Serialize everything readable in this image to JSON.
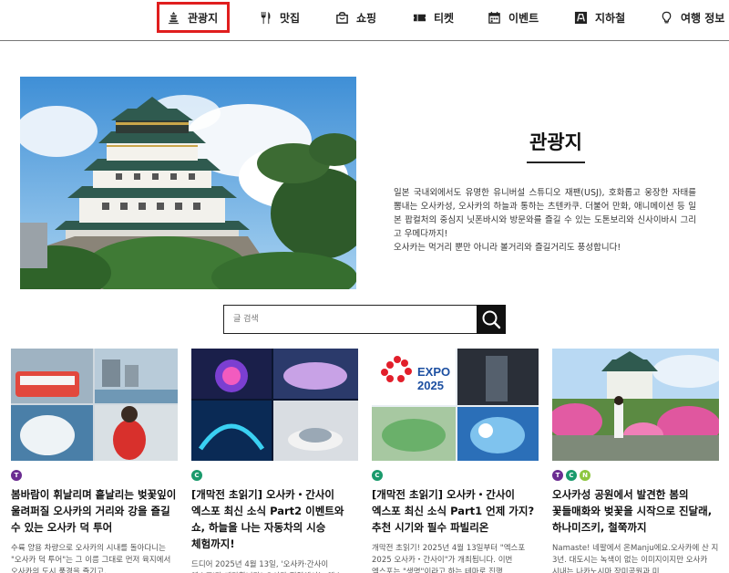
{
  "nav": {
    "items": [
      {
        "label": "관광지",
        "icon": "pagoda-icon",
        "active": true
      },
      {
        "label": "맛집",
        "icon": "fork-knife-icon"
      },
      {
        "label": "쇼핑",
        "icon": "shopping-bag-icon"
      },
      {
        "label": "티켓",
        "icon": "ticket-icon"
      },
      {
        "label": "이벤트",
        "icon": "calendar-icon"
      },
      {
        "label": "지하철",
        "icon": "subway-icon"
      },
      {
        "label": "여행 정보",
        "icon": "lightbulb-icon"
      }
    ],
    "active_outline_color": "#e01e1e"
  },
  "hero": {
    "title": "관광지",
    "description": [
      "일본 국내외에서도 유명한 유니버설 스튜디오 재팬(USJ), 호화롭고 웅장한 자태를 뽐내는 오사카성, 오사카의 하늘과 통하는 츠텐카쿠. 더불어 만화, 애니메이션 등 일본 팝컬처의 중심지 닛폰바시와 방문와를 즐길 수 있는 도톤보리와 신사이바시 그리고 우메다까지!",
      "오사카는 먹거리 뿐만 아니라 볼거리와 즐길거리도 풍성합니다!"
    ]
  },
  "search": {
    "placeholder": "글 검색"
  },
  "cards": [
    {
      "badges": [
        {
          "letter": "T",
          "color": "#6b2c91"
        }
      ],
      "title": "봄바람이 휘날리며 흩날리는 벚꽃잎이 울려퍼질 오사카의 거리와 강을 즐길 수 있는 오사카 덕 투어",
      "desc": "수륙 양용 차량으로 오사카의 시내를 돌아다니는 \"오사카 덕 투어\"는 그 이름 그대로 먼저 육지에서 오사카의 도시 풍경을 즐기고,"
    },
    {
      "badges": [
        {
          "letter": "C",
          "color": "#1a9a6c"
        }
      ],
      "title": "[개막전 초읽기] 오사카・간사이 엑스포 최신 소식 Part2 이벤트와 쇼, 하늘을 나는 자동차의 시승 체험까지!",
      "desc": "드디어 2025년 4월 13일, '오사카·간사이 엑스포'가 개막합니다! 오사카 전역에서는 엑스"
    },
    {
      "badges": [
        {
          "letter": "C",
          "color": "#1a9a6c"
        }
      ],
      "title": "[개막전 초읽기] 오사카・간사이 엑스포 최신 소식 Part1 언제 가지? 추천 시기와 필수 파빌리온",
      "desc": "개막전 초읽기! 2025년 4월 13일부터 \"엑스포 2025 오사카・간사이\"가 개최됩니다. 이번 엑스포는 \"생명\"이라고 하는 테마로 진행"
    },
    {
      "badges": [
        {
          "letter": "T",
          "color": "#6b2c91"
        },
        {
          "letter": "C",
          "color": "#1a9a6c"
        },
        {
          "letter": "N",
          "color": "#8dc63f"
        }
      ],
      "title": "오사카성 공원에서 발견한 봄의 꽃들매화와 벚꽃을 시작으로 진달래, 하나미즈키, 철쭉까지",
      "desc": "Namaste! 네팔에서 온Manju에요.오사카에 산 지 3년. 대도시는 녹색이 없는 이미지이지만 오사카 시내는 나카노시마 장미공원과 미"
    }
  ],
  "expo_badge": {
    "line1": "EXPO",
    "line2": "2025"
  }
}
